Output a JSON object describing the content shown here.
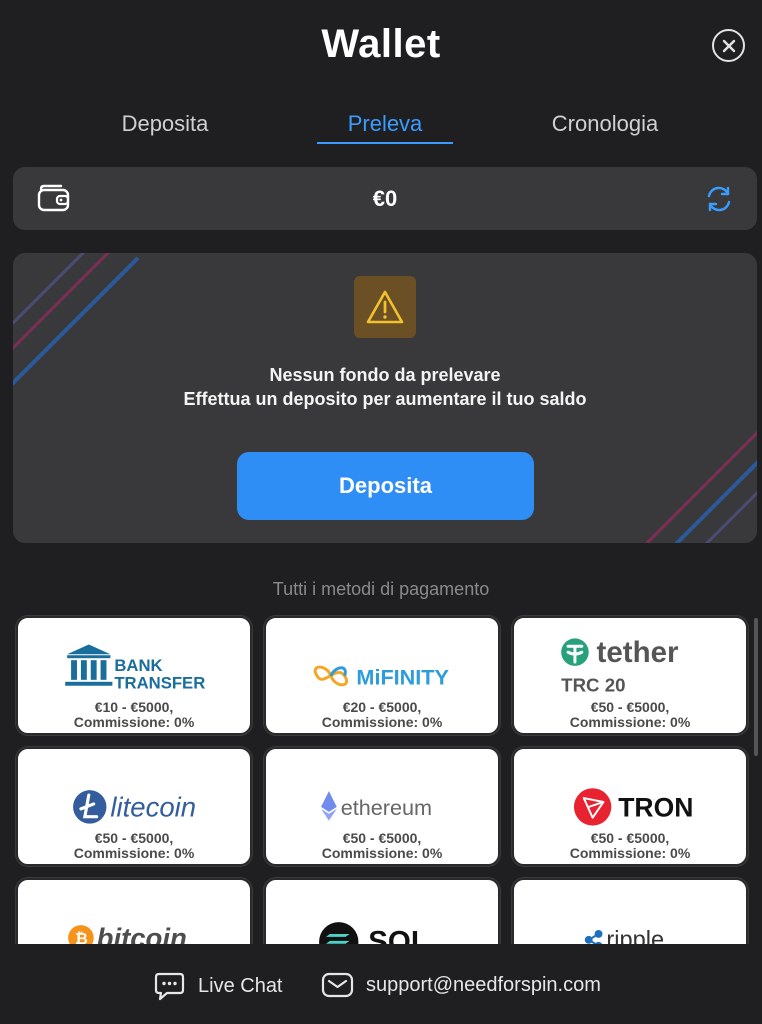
{
  "header": {
    "title": "Wallet",
    "close_icon": "close-icon"
  },
  "tabs": [
    {
      "label": "Deposita",
      "active": false
    },
    {
      "label": "Preleva",
      "active": true
    },
    {
      "label": "Cronologia",
      "active": false
    }
  ],
  "balance": {
    "amount": "€0",
    "wallet_icon": "wallet-icon",
    "refresh_icon": "refresh-icon"
  },
  "notice": {
    "icon": "warning-icon",
    "line1": "Nessun fondo da prelevare",
    "line2": "Effettua un deposito per aumentare il tuo saldo",
    "button_label": "Deposita"
  },
  "payment_methods": {
    "section_label": "Tutti i metodi di pagamento",
    "items": [
      {
        "name": "bank-transfer",
        "logo_line1": "BANK",
        "logo_line2": "TRANSFER",
        "range": "€10 - €5000,",
        "fee": "Commissione: 0%"
      },
      {
        "name": "mifinity",
        "logo_text": "MiFINITY",
        "range": "€20 - €5000,",
        "fee": "Commissione: 0%"
      },
      {
        "name": "tether",
        "logo_text": "tether",
        "logo_sub": "TRC 20",
        "range": "€50 - €5000,",
        "fee": "Commissione: 0%"
      },
      {
        "name": "litecoin",
        "logo_text": "litecoin",
        "range": "€50 - €5000,",
        "fee": "Commissione: 0%"
      },
      {
        "name": "ethereum",
        "logo_text": "ethereum",
        "range": "€50 - €5000,",
        "fee": "Commissione: 0%"
      },
      {
        "name": "tron",
        "logo_text": "TRON",
        "range": "€50 - €5000,",
        "fee": "Commissione: 0%"
      },
      {
        "name": "bitcoin",
        "logo_text": "bitcoin"
      },
      {
        "name": "solana",
        "logo_text": "SOL"
      },
      {
        "name": "ripple",
        "logo_text": "ripple"
      }
    ]
  },
  "footer": {
    "live_chat_label": "Live Chat",
    "support_email": "support@needforspin.com"
  },
  "colors": {
    "accent": "#3b9cff",
    "button": "#2f8ef6",
    "background": "#1f1f21",
    "panel": "#39393b"
  }
}
